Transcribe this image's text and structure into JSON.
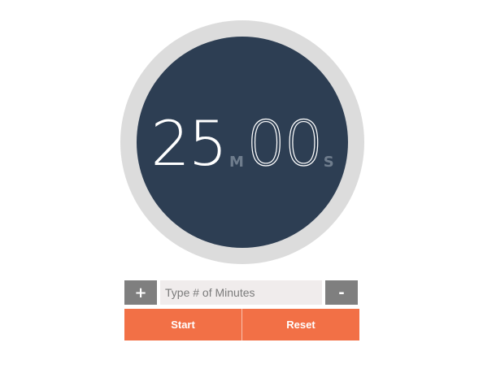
{
  "timer": {
    "minutes": "25",
    "minutes_unit": "M",
    "seconds": "00",
    "seconds_unit": "S"
  },
  "controls": {
    "increment_label": "+",
    "decrement_label": "-",
    "minutes_placeholder": "Type # of Minutes",
    "minutes_value": "",
    "start_label": "Start",
    "reset_label": "Reset"
  },
  "colors": {
    "face": "#2d3e53",
    "ring": "#dcdcdc",
    "accent": "#f27046",
    "step_button": "#7f7f7f",
    "input_bg": "#f0ecec"
  }
}
